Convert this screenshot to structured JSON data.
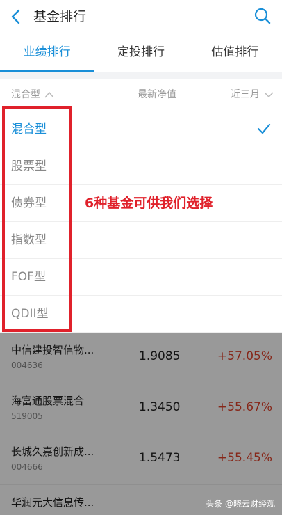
{
  "header": {
    "title": "基金排行"
  },
  "tabs": [
    {
      "label": "业绩排行",
      "active": true
    },
    {
      "label": "定投排行",
      "active": false
    },
    {
      "label": "估值排行",
      "active": false
    }
  ],
  "column_header": {
    "filter_label": "混合型",
    "nav_label": "最新净值",
    "period_label": "近三月"
  },
  "options": [
    {
      "label": "混合型",
      "selected": true
    },
    {
      "label": "股票型",
      "selected": false
    },
    {
      "label": "债券型",
      "selected": false
    },
    {
      "label": "指数型",
      "selected": false
    },
    {
      "label": "FOF型",
      "selected": false
    },
    {
      "label": "QDII型",
      "selected": false
    }
  ],
  "annotation": "6种基金可供我们选择",
  "funds": [
    {
      "name": "中信建投智信物...",
      "code": "004636",
      "nav": "1.9085",
      "change": "+57.05%"
    },
    {
      "name": "海富通股票混合",
      "code": "519005",
      "nav": "1.3450",
      "change": "+55.67%"
    },
    {
      "name": "长城久嘉创新成...",
      "code": "004666",
      "nav": "1.5473",
      "change": "+55.45%"
    },
    {
      "name": "华润元大信息传...",
      "code": "",
      "nav": "",
      "change": ""
    }
  ],
  "watermark": "头条 @晓云财经观",
  "colors": {
    "accent": "#1a8fd8",
    "annotation": "#e0212b",
    "positive_change": "#e0412a"
  }
}
